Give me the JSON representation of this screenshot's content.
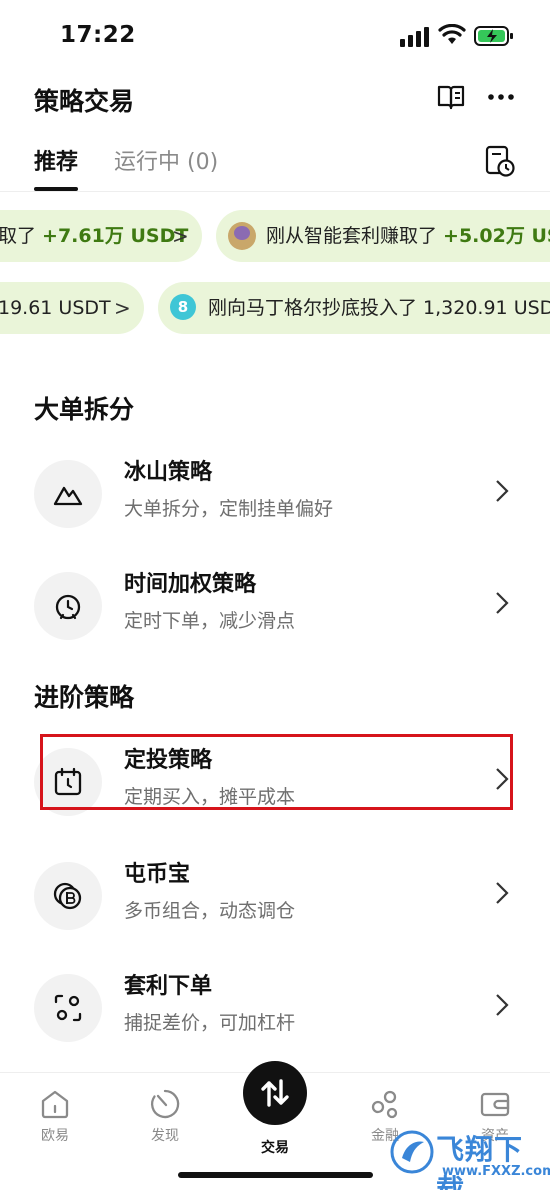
{
  "status_bar": {
    "time": "17:22"
  },
  "header": {
    "title": "策略交易"
  },
  "tabs": [
    {
      "label": "推荐",
      "active": true
    },
    {
      "label": "运行中 (0)",
      "active": false
    }
  ],
  "tickers": [
    {
      "prefix": "取了 ",
      "amount": "+7.61万 USDT",
      "suffix": ""
    },
    {
      "prefix": "刚从智能套利赚取了 ",
      "amount": "+5.02万 US",
      "suffix": ""
    },
    {
      "prefix": "19.61 USDT",
      "amount": "",
      "suffix": ""
    },
    {
      "badge": "8",
      "prefix": "刚向马丁格尔抄底投入了 1,320.91 USD",
      "amount": "",
      "suffix": ""
    }
  ],
  "sections": [
    {
      "title": "大单拆分",
      "items": [
        {
          "title": "冰山策略",
          "subtitle": "大单拆分，定制挂单偏好",
          "icon": "mountain-icon"
        },
        {
          "title": "时间加权策略",
          "subtitle": "定时下单，减少滑点",
          "icon": "alarm-clock-icon"
        }
      ]
    },
    {
      "title": "进阶策略",
      "items": [
        {
          "title": "定投策略",
          "subtitle": "定期买入，摊平成本",
          "icon": "calendar-clock-icon"
        },
        {
          "title": "屯币宝",
          "subtitle": "多币组合，动态调仓",
          "icon": "coins-b-icon"
        },
        {
          "title": "套利下单",
          "subtitle": "捕捉差价，可加杠杆",
          "icon": "arbitrage-icon"
        }
      ]
    }
  ],
  "bottom_nav": [
    {
      "label": "欧易",
      "icon": "home-icon"
    },
    {
      "label": "发现",
      "icon": "discover-icon"
    },
    {
      "label": "交易",
      "icon": "trade-icon",
      "active": true
    },
    {
      "label": "金融",
      "icon": "finance-icon"
    },
    {
      "label": "资产",
      "icon": "wallet-icon"
    }
  ],
  "watermark": {
    "text": "飞翔下载",
    "url": "www.FXXZ.com"
  },
  "colors": {
    "accent_green": "#3f7a12",
    "pill_bg": "#eaf5d9",
    "highlight": "#d6141b"
  }
}
